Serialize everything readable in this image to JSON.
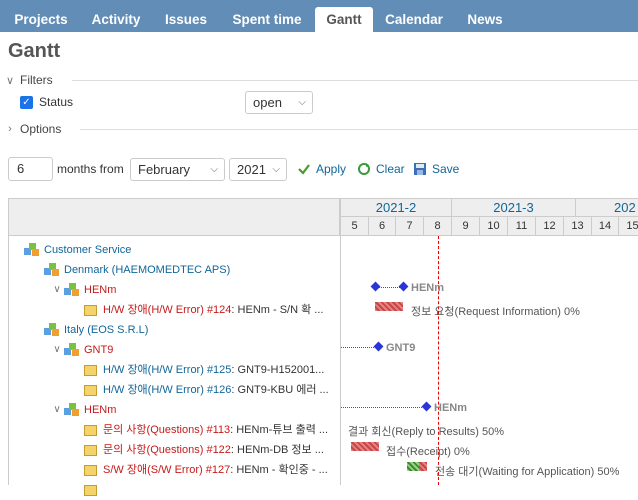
{
  "menu": {
    "tabs": [
      {
        "label": "Projects"
      },
      {
        "label": "Activity"
      },
      {
        "label": "Issues"
      },
      {
        "label": "Spent time"
      },
      {
        "label": "Gantt"
      },
      {
        "label": "Calendar"
      },
      {
        "label": "News"
      }
    ],
    "selected": "Gantt"
  },
  "page": {
    "title": "Gantt"
  },
  "filters": {
    "legend": "Filters",
    "status_label": "Status",
    "status_value": "open",
    "options_legend": "Options"
  },
  "period": {
    "months": "6",
    "months_from_label": "months from",
    "month_value": "February",
    "year_value": "2021",
    "apply": "Apply",
    "clear": "Clear",
    "save": "Save"
  },
  "gantt": {
    "months": [
      "2021-2",
      "2021-3",
      "202"
    ],
    "weeks": [
      "5",
      "6",
      "7",
      "8",
      "9",
      "10",
      "11",
      "12",
      "13",
      "14",
      "15"
    ],
    "rows": [
      {
        "text": "Customer Service"
      },
      {
        "text": "Denmark (HAEMOMEDTEC APS)"
      },
      {
        "text": "HENm"
      },
      {
        "prefix": "H/W 장애(H/W Error) #124",
        "rest": ": HENm - S/N 확 ..."
      },
      {
        "text": "Italy (EOS S.R.L)"
      },
      {
        "text": "GNT9"
      },
      {
        "prefix": "H/W 장애(H/W Error) #125",
        "rest": ": GNT9-H152001..."
      },
      {
        "prefix": "H/W 장애(H/W Error) #126",
        "rest": ": GNT9-KBU 에러 ..."
      },
      {
        "text": "HENm"
      },
      {
        "prefix": "문의 사항(Questions) #113",
        "rest": ": HENm-튜브 출력 ..."
      },
      {
        "prefix": "문의 사항(Questions) #122",
        "rest": ": HENm-DB 정보 ..."
      },
      {
        "prefix": "S/W 장애(S/W Error) #127",
        "rest": ": HENm - 확인중 - ..."
      }
    ],
    "bars": {
      "henm1": "HENm",
      "issue124": "정보 요청(Request Information) 0%",
      "gnt9": "GNT9",
      "henm2": "HENm",
      "issue113": "결과 회신(Reply to Results) 50%",
      "issue122": "접수(Receipt) 0%",
      "issue127": "전송 대기(Waiting for Application) 50%"
    }
  }
}
